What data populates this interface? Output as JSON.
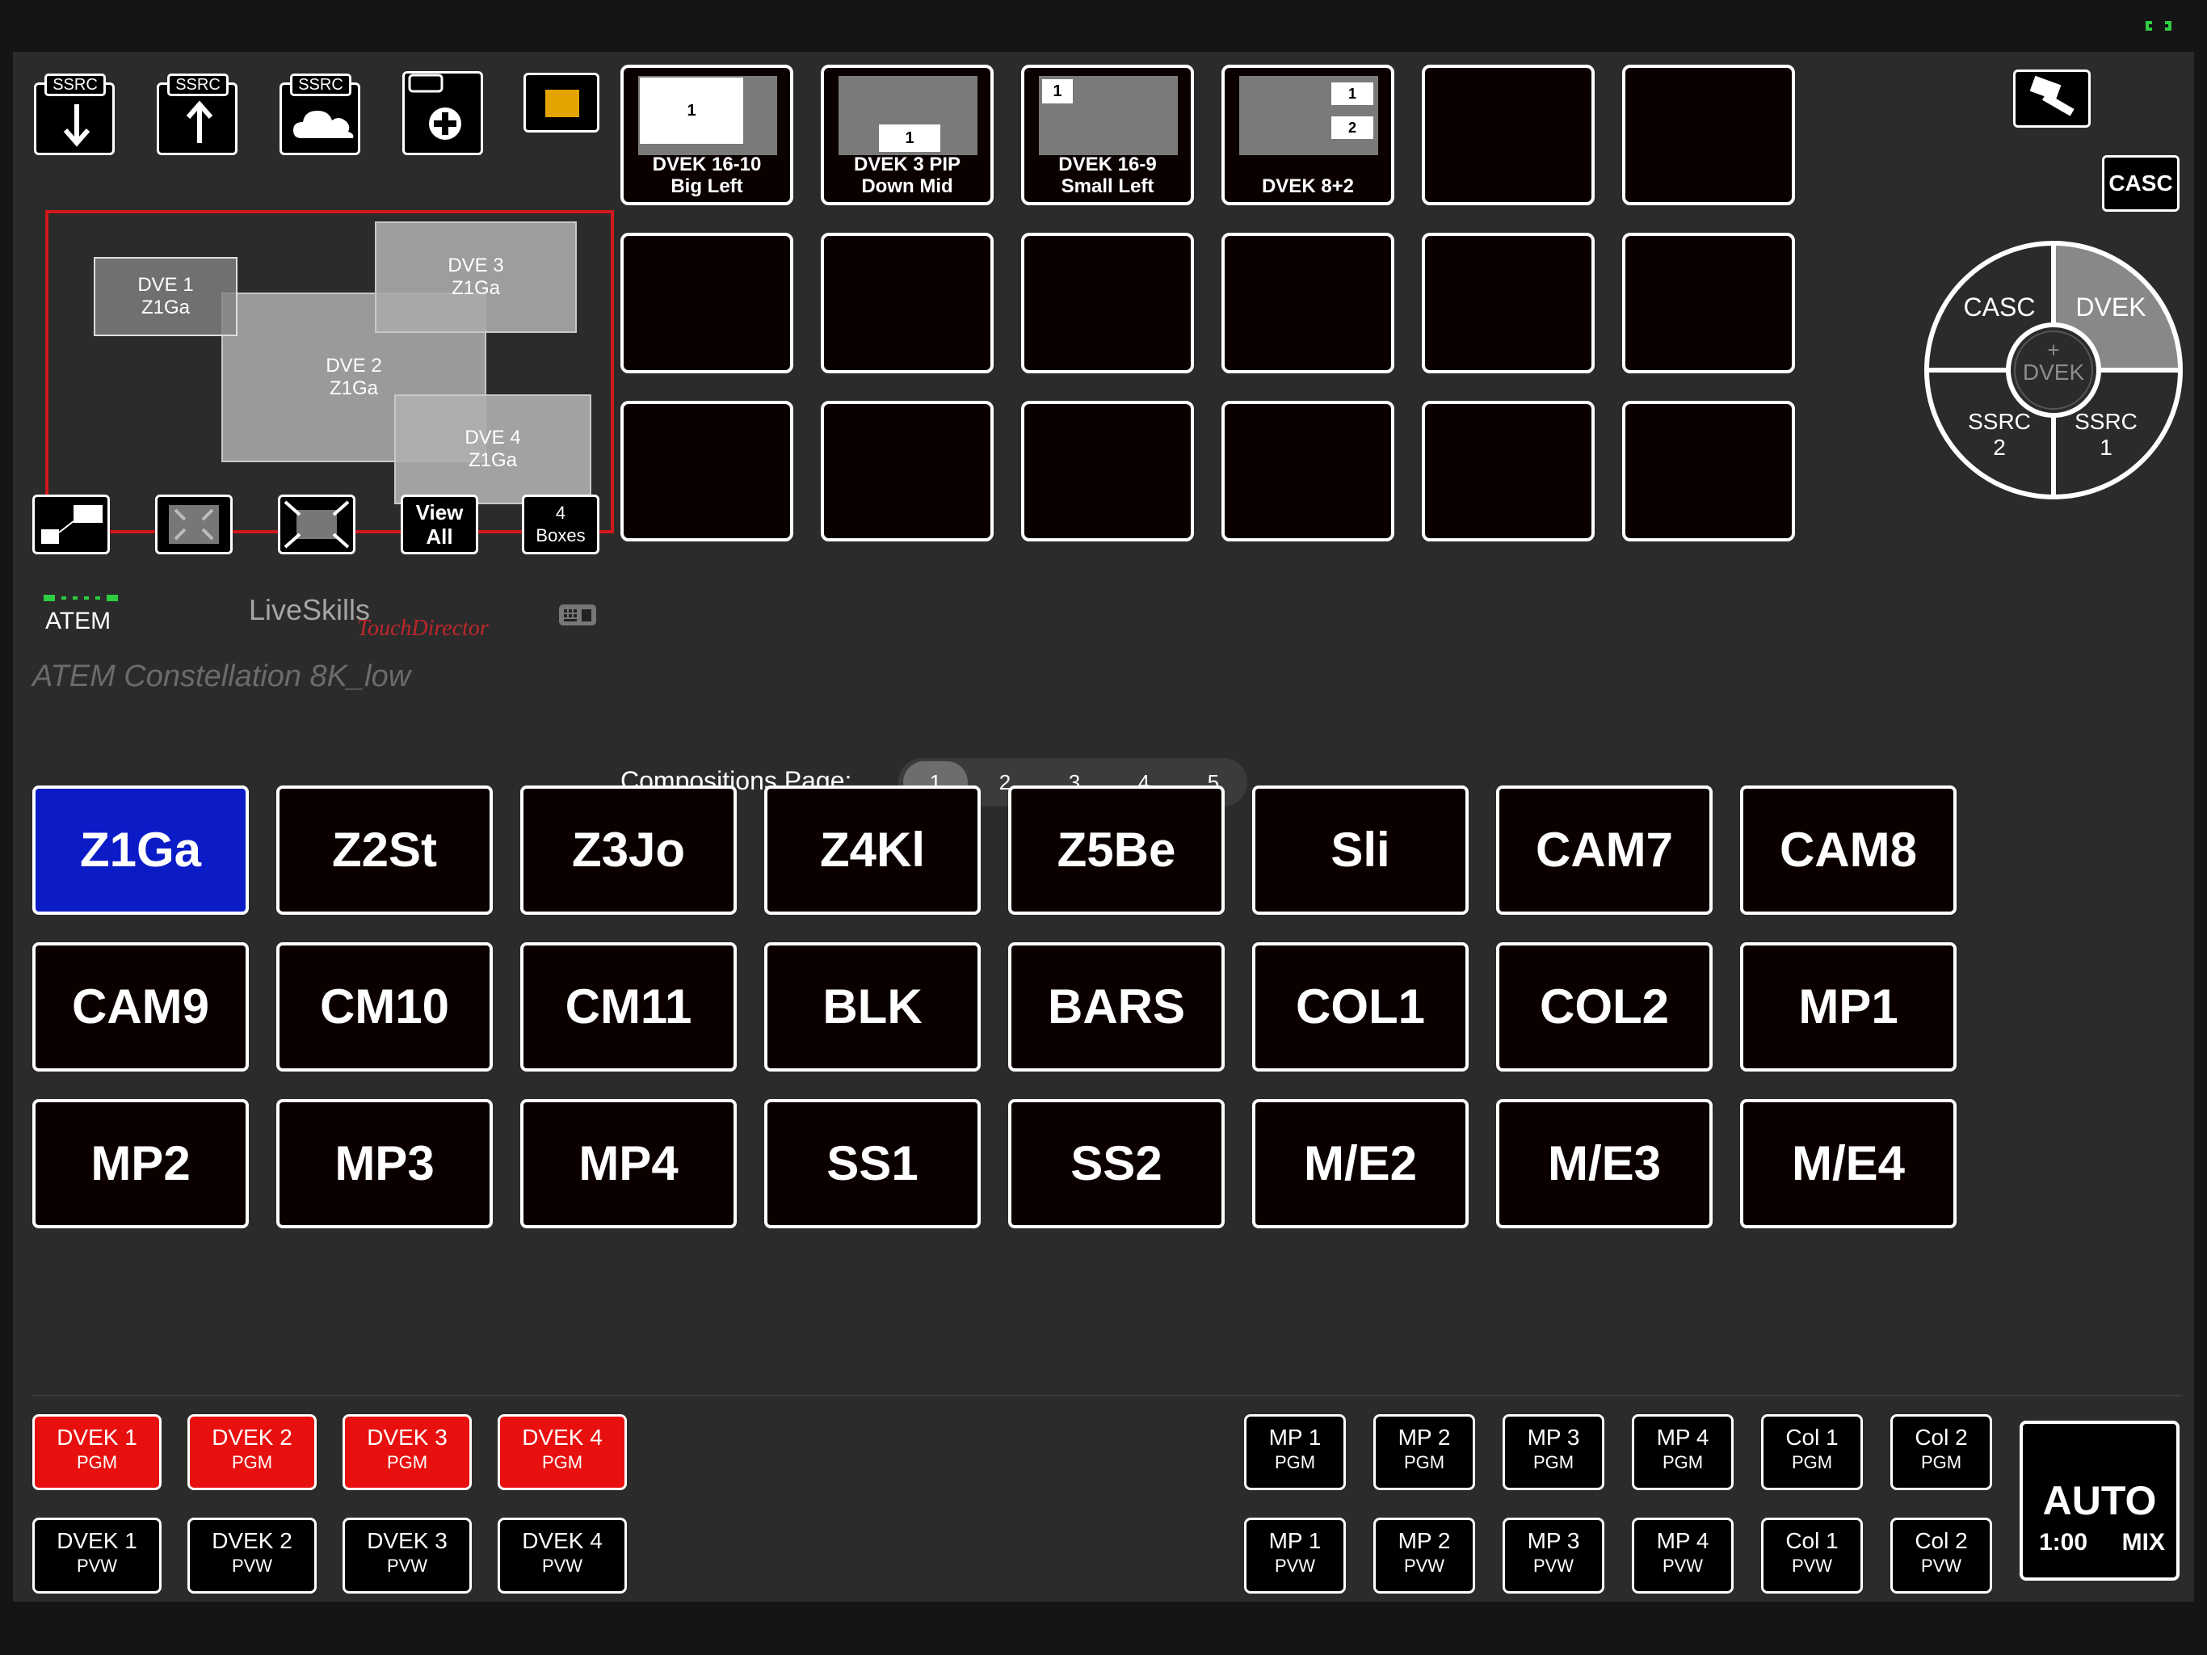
{
  "status": {
    "connection_icon": "link-icon",
    "connection_color": "#2ecc40"
  },
  "toolbar": {
    "ssrc_download_tag": "SSRC",
    "ssrc_upload_tag": "SSRC",
    "ssrc_cloud_tag": "SSRC",
    "color_swatch": "#e3a400",
    "view_all_line1": "View",
    "view_all_line2": "All",
    "boxes_line1": "4",
    "boxes_line2": "Boxes"
  },
  "preview": {
    "boxes": [
      {
        "label": "DVE 1",
        "source": "Z1Ga"
      },
      {
        "label": "DVE 2",
        "source": "Z1Ga"
      },
      {
        "label": "DVE 3",
        "source": "Z1Ga"
      },
      {
        "label": "DVE 4",
        "source": "Z1Ga"
      }
    ]
  },
  "device": {
    "atem_label": "ATEM",
    "brand_live": "LiveSkills",
    "brand_touch": "TouchDirector",
    "name": "ATEM Constellation 8K_low"
  },
  "layouts": {
    "tiles": [
      {
        "line1": "DVEK 16-10",
        "line2": "Big Left",
        "box1": "1"
      },
      {
        "line1": "DVEK 3 PIP",
        "line2": "Down Mid",
        "box1": "1"
      },
      {
        "line1": "DVEK 16-9",
        "line2": "Small Left",
        "box1": "1"
      },
      {
        "line1": "DVEK 8+2",
        "line2": "",
        "box1": "1",
        "box2": "2"
      }
    ]
  },
  "right_panel": {
    "hammer_icon": "hammer-icon",
    "casc_button": "CASC",
    "wheel": {
      "top_left": "CASC",
      "top_right": "DVEK",
      "bottom_left_1": "SSRC",
      "bottom_left_2": "2",
      "bottom_right_1": "SSRC",
      "bottom_right_2": "1",
      "center_plus": "+",
      "center_label": "DVEK"
    }
  },
  "pager": {
    "label": "Compositions Page:",
    "pages": [
      "1",
      "2",
      "3",
      "4",
      "5"
    ],
    "active": "1"
  },
  "sources": {
    "row1": [
      "Z1Ga",
      "Z2St",
      "Z3Jo",
      "Z4Kl",
      "Z5Be",
      "Sli",
      "CAM7",
      "CAM8"
    ],
    "row2": [
      "CAM9",
      "CM10",
      "CM11",
      "BLK",
      "BARS",
      "COL1",
      "COL2",
      "MP1"
    ],
    "row3": [
      "MP2",
      "MP3",
      "MP4",
      "SS1",
      "SS2",
      "M/E2",
      "M/E3",
      "M/E4"
    ],
    "active": "Z1Ga"
  },
  "bus": {
    "dvek_pgm": [
      {
        "name": "DVEK 1",
        "bus": "PGM"
      },
      {
        "name": "DVEK 2",
        "bus": "PGM"
      },
      {
        "name": "DVEK 3",
        "bus": "PGM"
      },
      {
        "name": "DVEK 4",
        "bus": "PGM"
      }
    ],
    "dvek_pvw": [
      {
        "name": "DVEK 1",
        "bus": "PVW"
      },
      {
        "name": "DVEK 2",
        "bus": "PVW"
      },
      {
        "name": "DVEK 3",
        "bus": "PVW"
      },
      {
        "name": "DVEK 4",
        "bus": "PVW"
      }
    ],
    "mp_pgm": [
      {
        "name": "MP 1",
        "bus": "PGM"
      },
      {
        "name": "MP 2",
        "bus": "PGM"
      },
      {
        "name": "MP 3",
        "bus": "PGM"
      },
      {
        "name": "MP 4",
        "bus": "PGM"
      },
      {
        "name": "Col 1",
        "bus": "PGM"
      },
      {
        "name": "Col 2",
        "bus": "PGM"
      }
    ],
    "mp_pvw": [
      {
        "name": "MP 1",
        "bus": "PVW"
      },
      {
        "name": "MP 2",
        "bus": "PVW"
      },
      {
        "name": "MP 3",
        "bus": "PVW"
      },
      {
        "name": "MP 4",
        "bus": "PVW"
      },
      {
        "name": "Col 1",
        "bus": "PVW"
      },
      {
        "name": "Col 2",
        "bus": "PVW"
      }
    ]
  },
  "auto": {
    "label": "AUTO",
    "rate": "1:00",
    "type": "MIX"
  },
  "colors": {
    "pgm_red": "#e8100f",
    "active_blue": "#0b1cc7",
    "preview_border": "#d2181c"
  }
}
